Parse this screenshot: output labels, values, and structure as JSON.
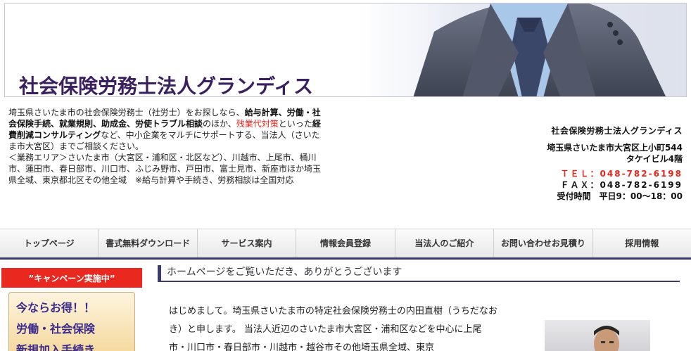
{
  "header": {
    "site_title": "社会保険労務士法人グランディス"
  },
  "intro": {
    "p1_a": "埼玉県さいたま市の社会保険労務士（社労士）をお探しなら、",
    "p1_b": "給与計算、労働・社会保険手続、就業規則、助成金、労使トラブル相談",
    "p1_c": "のほか、",
    "p1_d": "残業代対策",
    "p1_e": "といった",
    "p1_f": "経費削減コンサルティング",
    "p1_g": "など、中小企業をマルチにサポートする、当法人（さいたま市大宮区）までご相談ください。",
    "p2": "＜業務エリア＞さいたま市（大宮区・浦和区・北区など）、川越市、上尾市、桶川市、蓮田市、春日部市、川口市、ふじみ野市、戸田市、富士見市、新座市ほか埼玉県全域、東京都北区その他全域　※給与計算や手続き、労務相談は全国対応"
  },
  "contact": {
    "company": "社会保険労務士法人グランディス",
    "address1": "埼玉県さいたま市大宮区上小町544",
    "address2": "タケイビル4階",
    "tel": "ＴＥＬ：048-782-6198",
    "fax": "ＦＡＸ：048-782-6199",
    "hours": "受付時間　平日9：00〜18：00"
  },
  "nav": {
    "items": [
      "トップページ",
      "書式無料ダウンロード",
      "サービス案内",
      "情報会員登録",
      "当法人のご紹介",
      "お問い合わせお見積り",
      "採用情報"
    ]
  },
  "sidebar": {
    "campaign": "”キャンペーン実施中”",
    "banner_l1": "今ならお得！！",
    "banner_l2": "労働・社会保険",
    "banner_l3": "新規加入手続き"
  },
  "main": {
    "heading": "ホームページをご覧いただき、ありがとうございます",
    "text": "はじめまして。埼玉県さいたま市の特定社会保険労務士の内田直樹（うちだなおき）と申します。 当法人近辺のさいたま市大宮区・浦和区などを中心に上尾市・川口市・春日部市・川越市・越谷市その他埼玉県全域、東京"
  },
  "colors": {
    "title": "#3b2060",
    "accent_red": "#e8251c",
    "nav_border": "#3a3a6a"
  }
}
